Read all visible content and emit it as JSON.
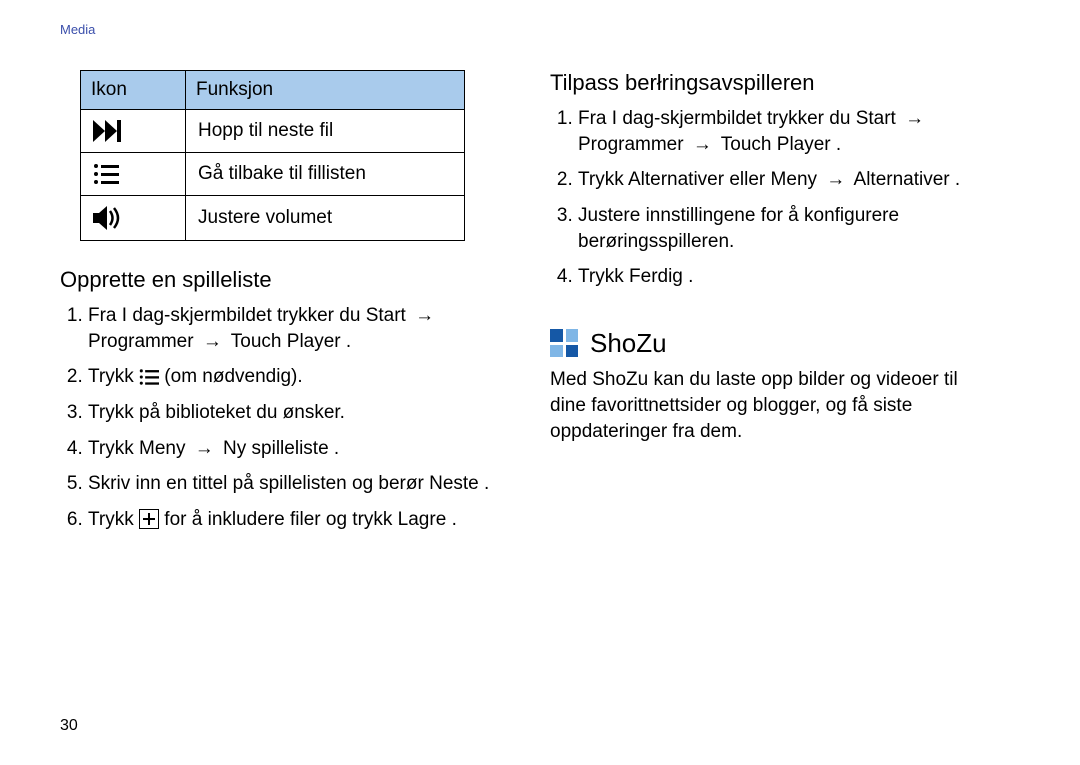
{
  "breadcrumb": "Media",
  "page_number": "30",
  "table": {
    "headers": {
      "icon": "Ikon",
      "func": "Funksjon"
    },
    "rows": [
      {
        "icon_name": "next-track-icon",
        "func": "Hopp til neste fil"
      },
      {
        "icon_name": "list-icon",
        "func": "Gå tilbake til fillisten"
      },
      {
        "icon_name": "volume-icon",
        "func": "Justere volumet"
      }
    ]
  },
  "left": {
    "section_title": "Opprette en spilleliste",
    "step1_a": "Fra I dag-skjermbildet trykker du ",
    "path_start": "Start",
    "path_prog": "Programmer",
    "path_touch": "Touch Player",
    "step2_a": "Trykk ",
    "step2_b": " (om nødvendig).",
    "step3": "Trykk på biblioteket du ønsker.",
    "step4_a": "Trykk ",
    "step4_meny": "Meny",
    "step4_ny": "Ny spilleliste",
    "step5_a": "Skriv inn en tittel på spillelisten og berør ",
    "step5_neste": "Neste",
    "step6_a": "Trykk ",
    "step6_b": " for å inkludere filer og trykk ",
    "step6_lagre": "Lagre"
  },
  "right": {
    "section_title": "Tilpass berłringsavspilleren",
    "step1_a": "Fra I dag-skjermbildet trykker du ",
    "path_start": "Start",
    "path_prog": "Programmer",
    "path_touch": "Touch Player",
    "step2_a": "Trykk ",
    "step2_alt": "Alternativer",
    "step2_eller": " eller ",
    "step2_meny": "Meny",
    "step2_alt2": "Alternativer",
    "step3": "Justere innstillingene for å konfigurere berøringsspilleren.",
    "step4_a": "Trykk ",
    "step4_ferdig": "Ferdig"
  },
  "shozu": {
    "title": "ShoZu",
    "body": "Med ShoZu kan du laste opp bilder og videoer til dine favorittnettsider og blogger, og få siste oppdateringer fra dem."
  },
  "period": "."
}
